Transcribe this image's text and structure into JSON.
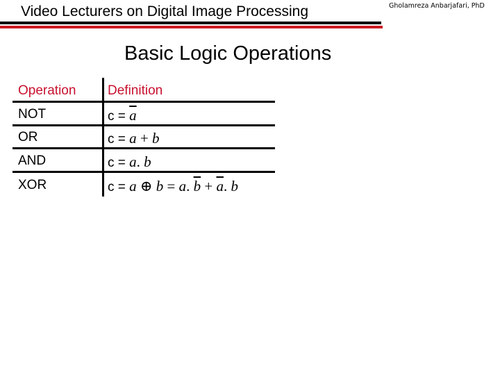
{
  "header": {
    "title": "Video Lecturers on Digital Image Processing",
    "author": "Gholamreza Anbarjafari,  PhD",
    "accent_color": "#cc1b22"
  },
  "slide": {
    "title": "Basic Logic Operations"
  },
  "table": {
    "columns": [
      "Operation",
      "Definition"
    ],
    "header_color": "#c8102e",
    "rows": [
      {
        "operation": "NOT",
        "definition_prefix": "c = ",
        "definition": "ā"
      },
      {
        "operation": "OR",
        "definition_prefix": "c = ",
        "definition": "a + b"
      },
      {
        "operation": "AND",
        "definition_prefix": "c = ",
        "definition": "a. b"
      },
      {
        "operation": "XOR",
        "definition_prefix": "c = ",
        "definition": "a ⊕ b = a. b̄ + ā. b"
      }
    ]
  }
}
